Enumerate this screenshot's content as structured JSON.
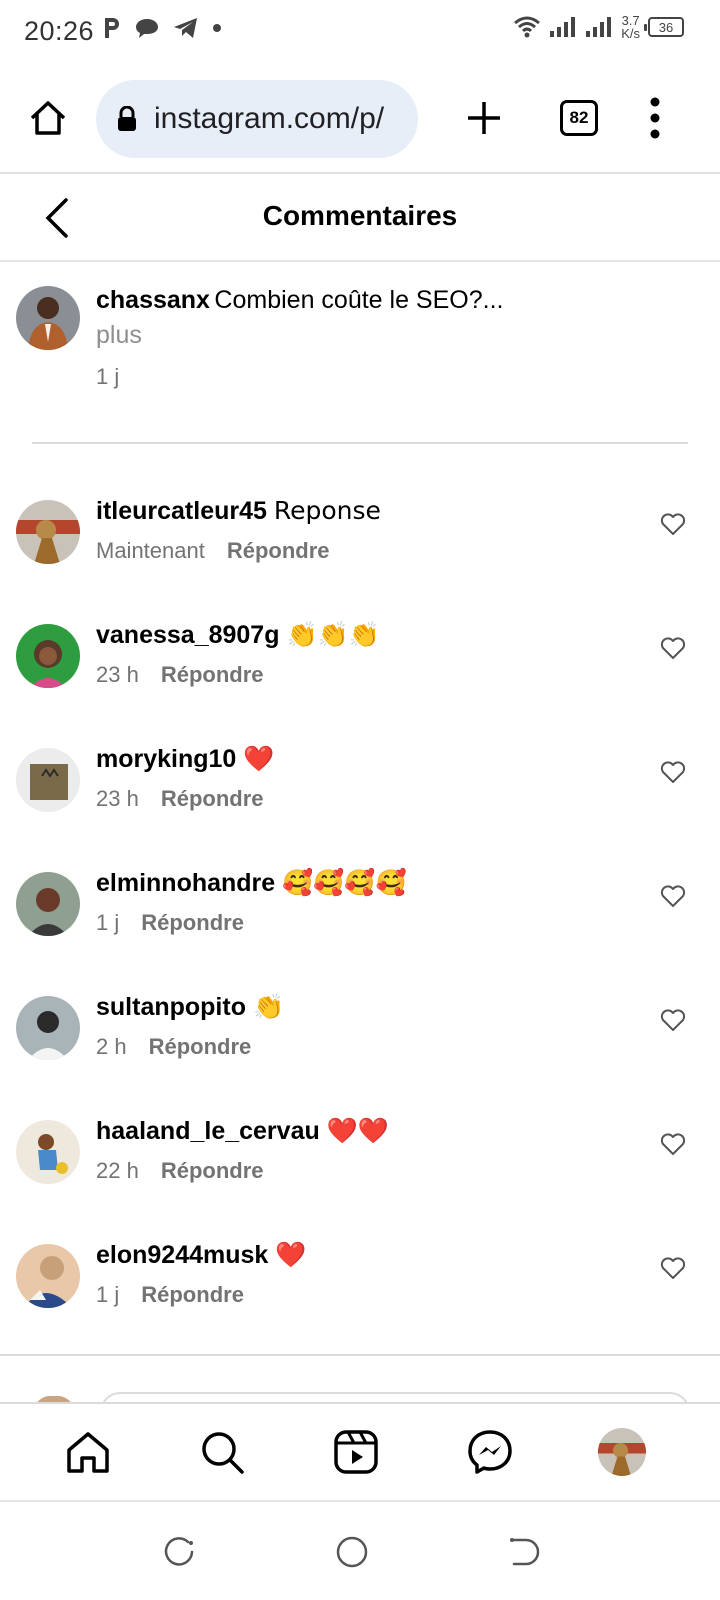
{
  "status_bar": {
    "time": "20:26",
    "net_speed_value": "3.7",
    "net_speed_unit": "K/s",
    "battery": "36"
  },
  "browser": {
    "url": "instagram.com/p/",
    "tab_count": "82"
  },
  "header": {
    "title": "Commentaires"
  },
  "caption": {
    "username": "chassanx",
    "text": "Combien coûte le SEO?...",
    "more": "plus",
    "time": "1 j"
  },
  "comments": [
    {
      "username": "itleurcatleur45",
      "text": "Reponse",
      "time": "Maintenant",
      "reply": "Répondre",
      "avatar_color": "#b5462e"
    },
    {
      "username": "vanessa_8907g",
      "text": "👏👏👏",
      "time": "23 h",
      "reply": "Répondre",
      "avatar_color": "#2e9d3f"
    },
    {
      "username": "moryking10",
      "text": "❤️",
      "time": "23 h",
      "reply": "Répondre",
      "avatar_color": "#7a6a4a"
    },
    {
      "username": "elminnohandre",
      "text": "🥰🥰🥰🥰",
      "time": "1 j",
      "reply": "Répondre",
      "avatar_color": "#6f7f72"
    },
    {
      "username": "sultanpopito",
      "text": "👏",
      "time": "2 h",
      "reply": "Répondre",
      "avatar_color": "#3f5c66"
    },
    {
      "username": "haaland_le_cervau",
      "text": "❤️❤️",
      "time": "22 h",
      "reply": "Répondre",
      "avatar_color": "#d8c9a8"
    },
    {
      "username": "elon9244musk",
      "text": "❤️",
      "time": "1 j",
      "reply": "Répondre",
      "avatar_color": "#c7a07a"
    }
  ],
  "bottom_nav": {
    "items": [
      "home-icon",
      "search-icon",
      "reels-icon",
      "messenger-icon",
      "profile-avatar"
    ]
  },
  "colors": {
    "url_bg": "#e7eef8",
    "muted_text": "#737373",
    "divider": "#dbdbdb"
  }
}
